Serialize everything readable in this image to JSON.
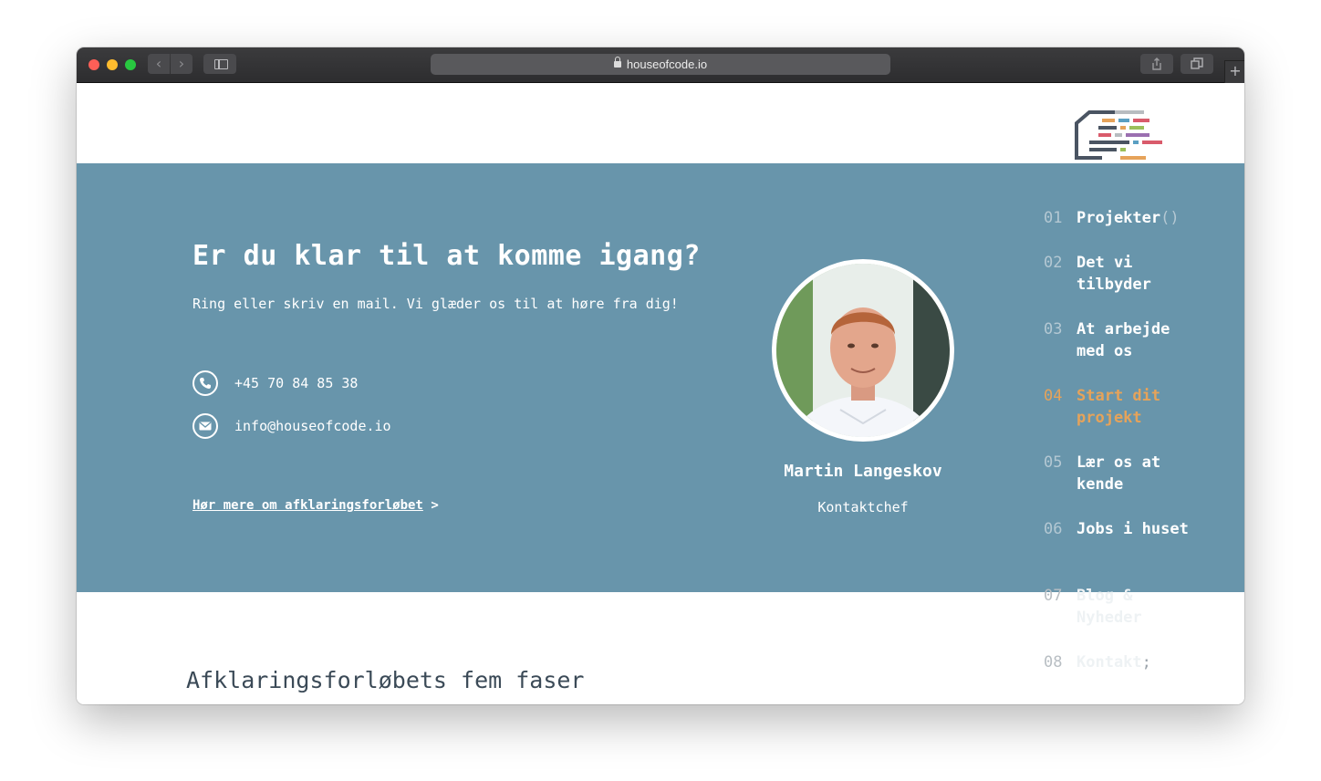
{
  "browser": {
    "url": "houseofcode.io",
    "back_icon": "chevron-left-icon",
    "forward_icon": "chevron-right-icon",
    "share_icon": "share-icon",
    "tabs_icon": "tabs-icon",
    "new_tab_label": "+"
  },
  "colors": {
    "hero_bg": "#6895ab",
    "accent": "#e6a35a",
    "text_dark": "#3b4a57"
  },
  "hero": {
    "title": "Er du klar til at komme igang?",
    "subtitle": "Ring eller skriv en mail. Vi glæder os til at høre fra dig!",
    "phone": "+45 70 84 85 38",
    "email": "info@houseofcode.io",
    "link_label": "Hør mere om afklaringsforløbet",
    "link_arrow": ">"
  },
  "contact_person": {
    "name": "Martin Langeskov",
    "role": "Kontaktchef"
  },
  "side_nav": {
    "items": [
      {
        "num": "01",
        "label": "Projekter",
        "suffix": "()"
      },
      {
        "num": "02",
        "label": "Det vi tilbyder"
      },
      {
        "num": "03",
        "label": "At arbejde med os"
      },
      {
        "num": "04",
        "label": "Start dit projekt",
        "active": true
      },
      {
        "num": "05",
        "label": "Lær os at kende"
      },
      {
        "num": "06",
        "label": "Jobs i huset"
      },
      {
        "num": "07",
        "label": "Blog & Nyheder"
      },
      {
        "num": "08",
        "label": "Kontakt",
        "suffix": ";"
      }
    ]
  },
  "section": {
    "title": "Afklaringsforløbets fem faser"
  }
}
